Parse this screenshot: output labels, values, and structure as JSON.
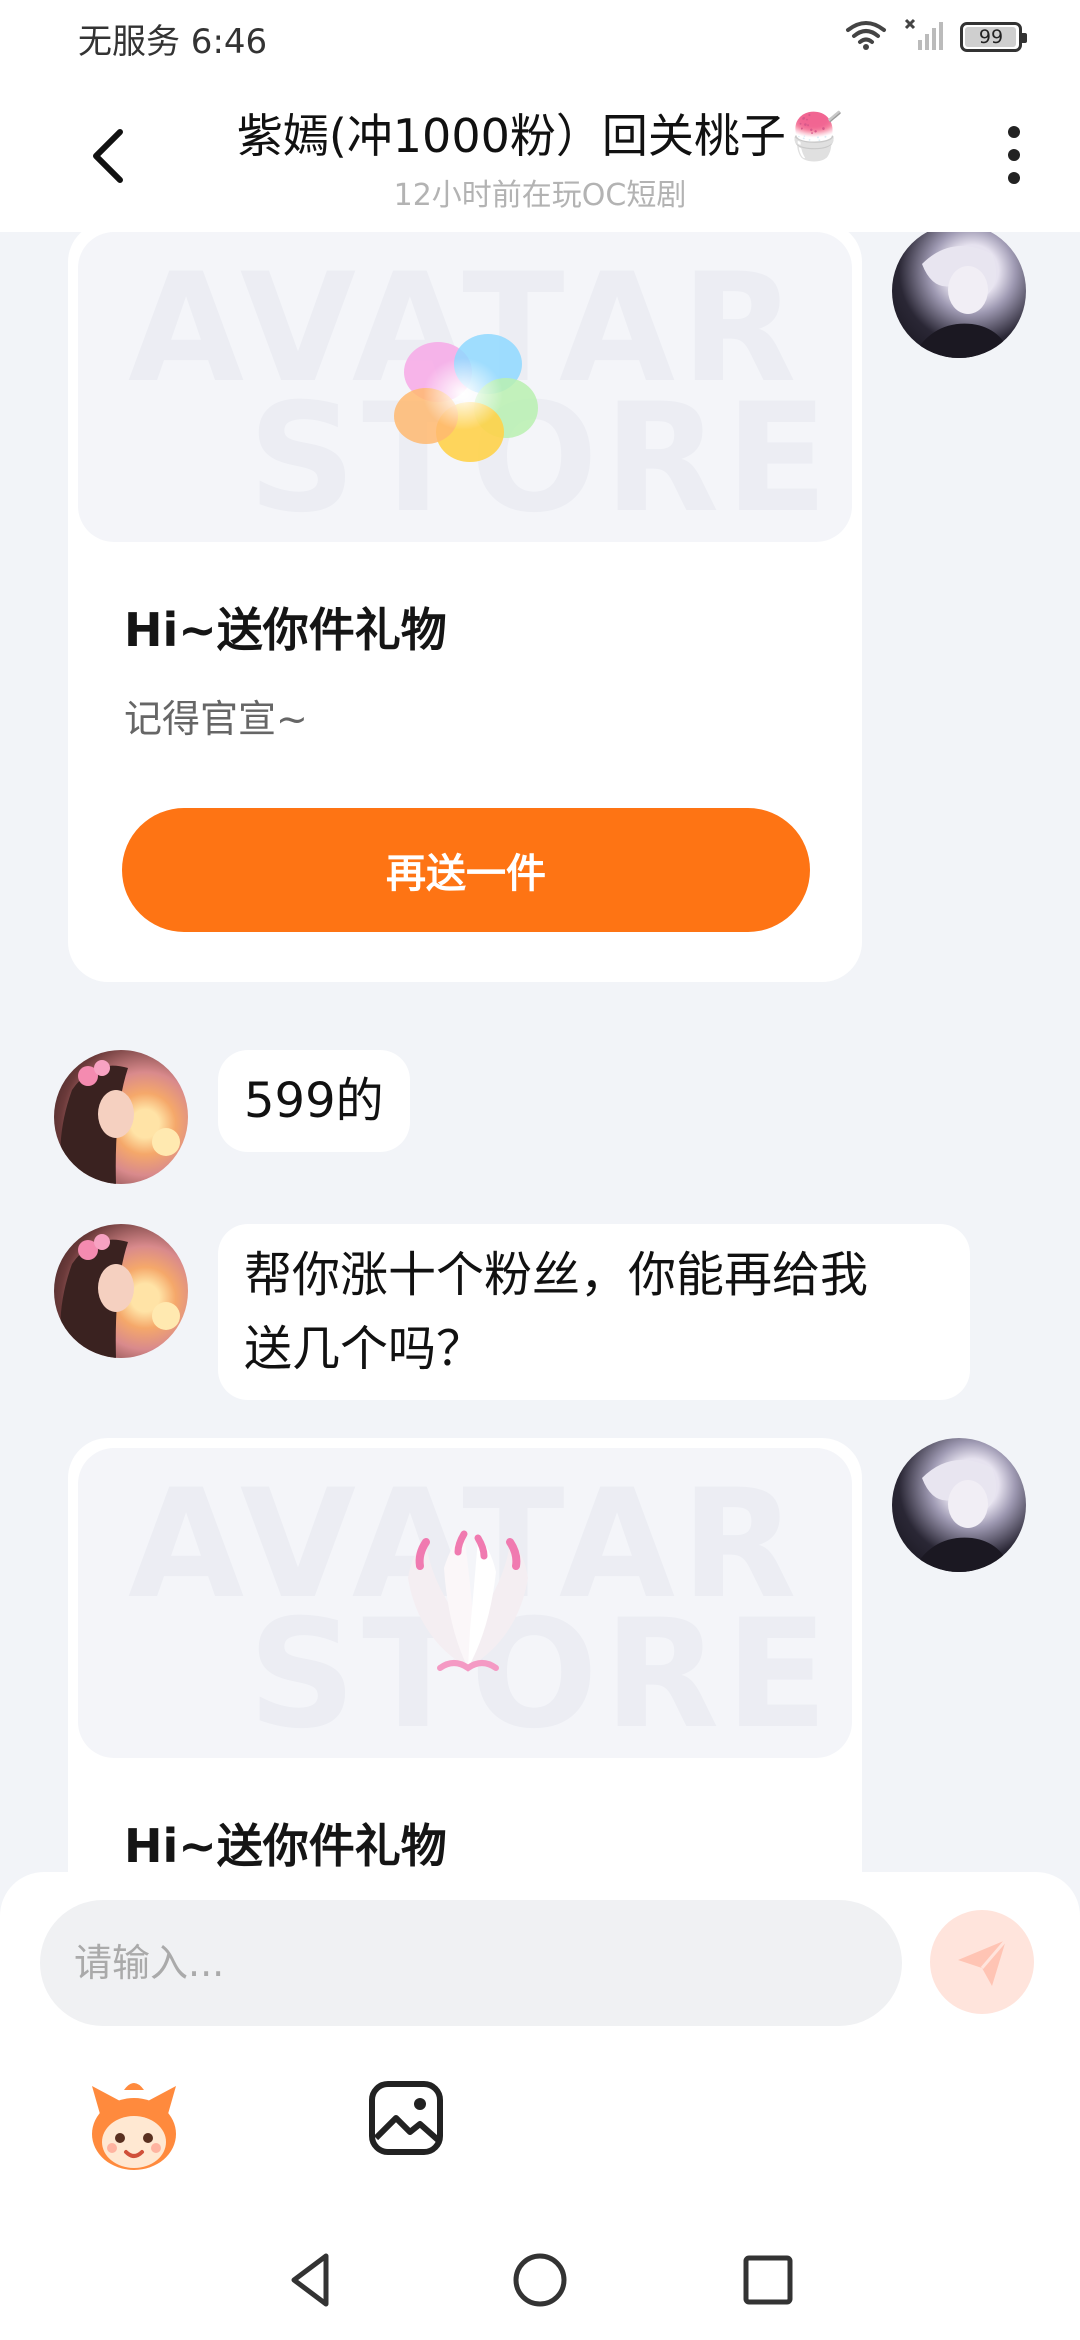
{
  "status_bar": {
    "carrier_time": "无服务 6:46",
    "battery": "99",
    "battery_level": 0.99,
    "icons": [
      "wifi-icon",
      "signal-off-icon",
      "battery-icon"
    ]
  },
  "header": {
    "title": "紫嫣(冲1000粉）回关桃子🍧",
    "subtitle": "12小时前在玩OC短剧",
    "icons": [
      "back-arrow-icon",
      "more-vertical-icon"
    ]
  },
  "messages": [
    {
      "type": "gift",
      "sender": "self",
      "watermark": [
        "AVATAR",
        "STORE"
      ],
      "gift_icon": "rainbow-flower-icon",
      "title": "Hi~送你件礼物",
      "description": "记得官宣~",
      "button_label": "再送一件"
    },
    {
      "type": "text",
      "sender": "other",
      "text": "599的"
    },
    {
      "type": "text",
      "sender": "other",
      "lines": [
        "帮你涨十个粉丝，你能再给我",
        "送几个吗？"
      ]
    },
    {
      "type": "gift",
      "sender": "self",
      "watermark": [
        "AVATAR",
        "STORE"
      ],
      "gift_icon": "fox-tails-icon",
      "title": "Hi~送你件礼物"
    }
  ],
  "composer": {
    "placeholder": "请输入...",
    "send_icon": "paper-plane-icon",
    "tools": [
      "mascot-sticker-icon",
      "image-picker-icon"
    ]
  },
  "nav_bar": {
    "icons": [
      "nav-back-icon",
      "nav-home-icon",
      "nav-recents-icon"
    ]
  },
  "colors": {
    "accent": "#fe7414",
    "chat_background": "#f2f4f8",
    "send_button_bg": "#ffe4dc"
  }
}
